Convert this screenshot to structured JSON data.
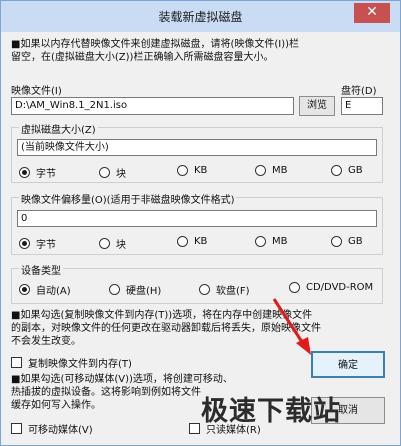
{
  "window": {
    "title": "装载新虚拟磁盘",
    "close_glyph": "✕"
  },
  "intro": {
    "line1": "■如果以内存代替映像文件来创建虚拟磁盘，请将(映像文件(I))栏",
    "line2": "留空，在(虚拟磁盘大小(Z))栏正确输入所需磁盘容量大小。"
  },
  "image_file": {
    "label": "映像文件(I)",
    "value": "D:\\AM_Win8.1_2N1.iso",
    "browse_label": "浏览"
  },
  "drive": {
    "label": "盘符(D)",
    "value": "E"
  },
  "size_group": {
    "label": "虚拟磁盘大小(Z)",
    "value": "(当前映像文件大小)",
    "units": [
      "字节",
      "块",
      "KB",
      "MB",
      "GB"
    ],
    "selected": "字节"
  },
  "offset_group": {
    "label": "映像文件偏移量(O)(适用于非磁盘映像文件格式)",
    "value": "0",
    "units": [
      "字节",
      "块",
      "KB",
      "MB",
      "GB"
    ],
    "selected": "字节"
  },
  "device_group": {
    "label": "设备类型",
    "options": [
      "自动(A)",
      "硬盘(H)",
      "软盘(F)",
      "CD/DVD-ROM"
    ],
    "selected": "自动(A)"
  },
  "copy_note": {
    "line1": "■如果勾选(复制映像文件到内存(T))选项，将在内存中创建映像文件",
    "line2": "的副本，对映像文件的任何更改在驱动器卸载后将丢失，原始映像文件",
    "line3": "不会发生改变。"
  },
  "copy_checkbox": {
    "label": "复制映像文件到内存(T)",
    "checked": false
  },
  "removable_note": {
    "line1": "■如果勾选(可移动媒体(V))选项，将创建可移动、",
    "line2": "热插拔的虚拟设备。这将影响到例如将文件",
    "line3": "缓存如何写入操作。"
  },
  "removable_checkbox": {
    "label": "可移动媒体(V)",
    "checked": false
  },
  "readonly_checkbox": {
    "label": "只读媒体(R)",
    "checked": false
  },
  "ok_label": "确定",
  "cancel_label": "取消",
  "watermark": "极速下载站",
  "colors": {
    "arrow": "#e31a1a",
    "titlebar": "#c9dcf3",
    "close": "#c75050"
  }
}
